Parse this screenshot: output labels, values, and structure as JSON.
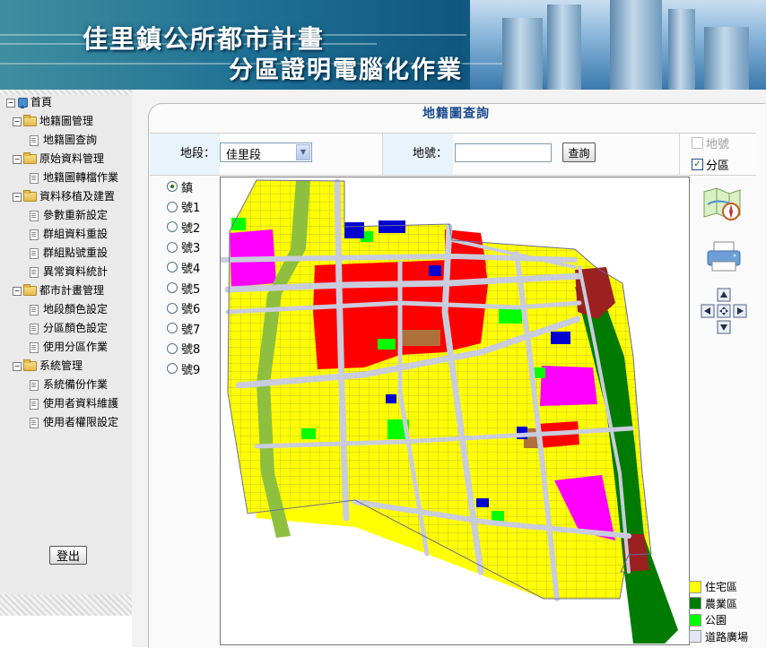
{
  "header": {
    "title_line1": "佳里鎮公所都市計畫",
    "title_line2": "分區證明電腦化作業"
  },
  "sidebar": {
    "root_label": "首頁",
    "groups": [
      {
        "label": "地籍圖管理",
        "items": [
          "地籍圖查詢"
        ]
      },
      {
        "label": "原始資料管理",
        "items": [
          "地籍圖轉檔作業"
        ]
      },
      {
        "label": "資料移植及建置",
        "items": [
          "參數重新設定",
          "群組資料重設",
          "群組點號重設",
          "異常資料統計"
        ]
      },
      {
        "label": "都市計畫管理",
        "items": [
          "地段顏色設定",
          "分區顏色設定",
          "使用分區作業"
        ]
      },
      {
        "label": "系統管理",
        "items": [
          "系統備份作業",
          "使用者資料維護",
          "使用者權限設定"
        ]
      }
    ],
    "logout_label": "登出"
  },
  "page": {
    "title": "地籍圖查詢"
  },
  "form": {
    "district_label": "地段：",
    "district_value": "佳里段",
    "lot_label": "地號：",
    "lot_value": "",
    "query_label": "查詢",
    "checkbox_lot": {
      "label": "地號",
      "checked": false,
      "enabled": false
    },
    "checkbox_zone": {
      "label": "分區",
      "checked": true,
      "enabled": true
    }
  },
  "radios": {
    "selected": "鎮",
    "options": [
      "鎮",
      "號1",
      "號2",
      "號3",
      "號4",
      "號5",
      "號6",
      "號7",
      "號8",
      "號9"
    ]
  },
  "tools": [
    "map-search-icon",
    "printer-icon",
    "pan-arrows-icon"
  ],
  "legend": [
    {
      "label": "住宅區",
      "color": "#ffff00"
    },
    {
      "label": "農業區",
      "color": "#007a00"
    },
    {
      "label": "公園",
      "color": "#00ff00"
    },
    {
      "label": "道路廣場",
      "color": "#e4e6f5"
    }
  ],
  "map_colors": {
    "residential": "#ffff00",
    "commercial": "#ff0000",
    "agricultural": "#007a00",
    "park": "#00ff00",
    "institution": "#ff00ff",
    "school": "#0000d0",
    "green_belt": "#8fbf3f",
    "road": "#c9ccdc",
    "brownish": "#b0703a",
    "dark_red": "#9b2020"
  }
}
